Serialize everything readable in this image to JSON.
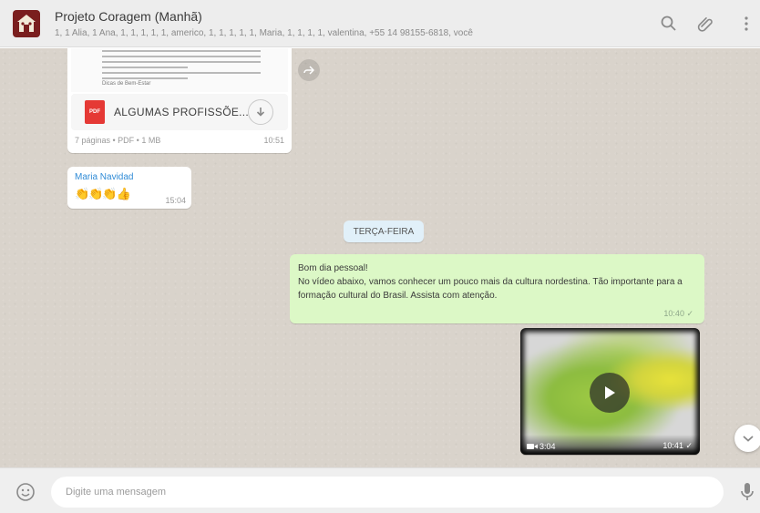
{
  "header": {
    "title": "Projeto Coragem (Manhã)",
    "members": "1, 1 Alia, 1 Ana, 1, 1, 1, 1, 1, americo, 1, 1, 1, 1, 1, Maria, 1, 1, 1, 1, valentina, +55 14 98155-6818, você",
    "icons": [
      "search-icon",
      "attach-icon",
      "menu-icon"
    ]
  },
  "messages": {
    "document": {
      "filename": "ALGUMAS PROFISSÕE...",
      "preview_caption": "Dicas de Bem-Estar",
      "meta": "7 páginas • PDF • 1 MB",
      "time": "10:51",
      "file_type": "PDF"
    },
    "incoming": {
      "sender": "Maria Navidad",
      "emojis": "👏👏👏👍",
      "time": "15:04"
    },
    "date_chip": "TERÇA-FEIRA",
    "outgoing": {
      "lines": [
        "Bom dia pessoal!",
        "No vídeo abaixo, vamos conhecer um pouco mais da cultura nordestina. Tão importante para a formação cultural do Brasil. Assista com atenção."
      ],
      "time": "10:40 ✓"
    },
    "video": {
      "duration": "3:04",
      "time": "10:41 ✓"
    }
  },
  "footer": {
    "placeholder": "Digite uma mensagem"
  },
  "colors": {
    "chat_background": "#d9d3cb",
    "outgoing_bubble": "#dcf8c6",
    "incoming_bubble": "#ffffff",
    "sender_name": "#2f8bd6",
    "pdf_red": "#e53935",
    "date_chip": "#e1f0f9"
  }
}
